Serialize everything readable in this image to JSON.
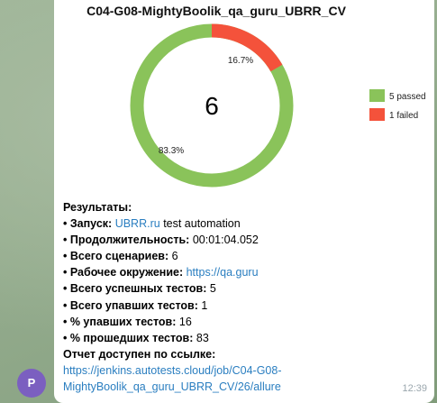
{
  "chart_data": {
    "type": "pie",
    "title": "C04-G08-MightyBoolik_qa_guru_UBRR_CV",
    "categories": [
      "passed",
      "failed"
    ],
    "values": [
      5,
      1
    ],
    "total": "6",
    "labels": [
      "83.3%",
      "16.7%"
    ],
    "legend": [
      "5 passed",
      "1 failed"
    ],
    "colors": [
      "#8ac35a",
      "#f4523b"
    ],
    "legend_position": "right"
  },
  "message": {
    "avatar_letter": "P",
    "heading": "Результаты:",
    "launch": {
      "label": "• Запуск:",
      "link": "UBRR.ru",
      "rest": "test automation"
    },
    "duration": {
      "label": "• Продолжительность:",
      "value": "00:01:04.052"
    },
    "scenarios": {
      "label": "• Всего сценариев:",
      "value": "6"
    },
    "environment": {
      "label": "• Рабочее окружение:",
      "link": "https://qa.guru"
    },
    "passed": {
      "label": "• Всего успешных тестов:",
      "value": "5"
    },
    "failed": {
      "label": "• Всего упавших тестов:",
      "value": "1"
    },
    "failed_pct": {
      "label": "• % упавших тестов:",
      "value": "16"
    },
    "passed_pct": {
      "label": "• % прошедших тестов:",
      "value": "83"
    },
    "report_heading": "Отчет доступен по ссылке:",
    "report_link_line1": "https://jenkins.autotests.cloud/job/C04-G08-",
    "report_link_line2": "MightyBoolik_qa_guru_UBRR_CV/26/allure",
    "time": "12:39"
  }
}
